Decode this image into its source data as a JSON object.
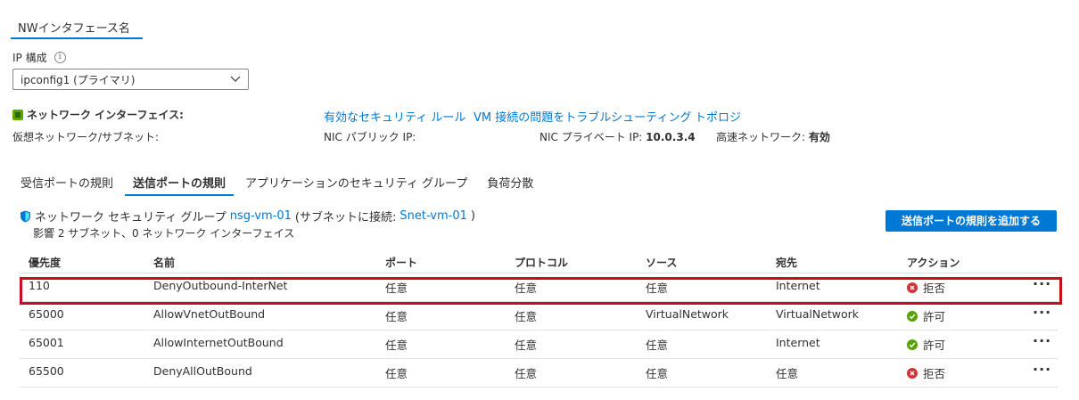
{
  "header": {
    "tab_title": "NWインタフェース名"
  },
  "ip_config": {
    "label": "IP 構成",
    "selected": "ipconfig1 (プライマリ)"
  },
  "nic": {
    "title": "ネットワーク インターフェイス:",
    "vnet_label": "仮想ネットワーク/サブネット:",
    "links": [
      "有効なセキュリティ ルール",
      "VM 接続の問題をトラブルシューティング",
      "トポロジ"
    ],
    "public_ip_label": "NIC パブリック IP:",
    "private_ip_label": "NIC プライベート IP:",
    "private_ip_value": "10.0.3.4",
    "accel_label": "高速ネットワーク:",
    "accel_value": "有効"
  },
  "tabs": [
    "受信ポートの規則",
    "送信ポートの規則",
    "アプリケーションのセキュリティ グループ",
    "負荷分散"
  ],
  "active_tab": "送信ポートの規則",
  "nsg": {
    "prefix": "ネットワーク セキュリティ グループ",
    "name": "nsg-vm-01",
    "subnet_prefix": "(サブネットに接続:",
    "subnet_name": "Snet-vm-01",
    "subnet_suffix": ")",
    "impact": "影響 2 サブネット、0 ネットワーク インターフェイス"
  },
  "add_button": "送信ポートの規則を追加する",
  "table": {
    "columns": [
      "優先度",
      "名前",
      "ポート",
      "プロトコル",
      "ソース",
      "宛先",
      "アクション"
    ],
    "rows": [
      {
        "priority": "110",
        "name": "DenyOutbound-InterNet",
        "port": "任意",
        "protocol": "任意",
        "source": "任意",
        "dest": "Internet",
        "action": "拒否",
        "action_type": "deny"
      },
      {
        "priority": "65000",
        "name": "AllowVnetOutBound",
        "port": "任意",
        "protocol": "任意",
        "source": "VirtualNetwork",
        "dest": "VirtualNetwork",
        "action": "許可",
        "action_type": "allow"
      },
      {
        "priority": "65001",
        "name": "AllowInternetOutBound",
        "port": "任意",
        "protocol": "任意",
        "source": "任意",
        "dest": "Internet",
        "action": "許可",
        "action_type": "allow"
      },
      {
        "priority": "65500",
        "name": "DenyAllOutBound",
        "port": "任意",
        "protocol": "任意",
        "source": "任意",
        "dest": "任意",
        "action": "拒否",
        "action_type": "deny"
      }
    ],
    "more_glyph": "···"
  },
  "colors": {
    "accent": "#0078d4",
    "deny": "#d13438",
    "allow": "#57a300",
    "highlight": "#c50f1f"
  }
}
